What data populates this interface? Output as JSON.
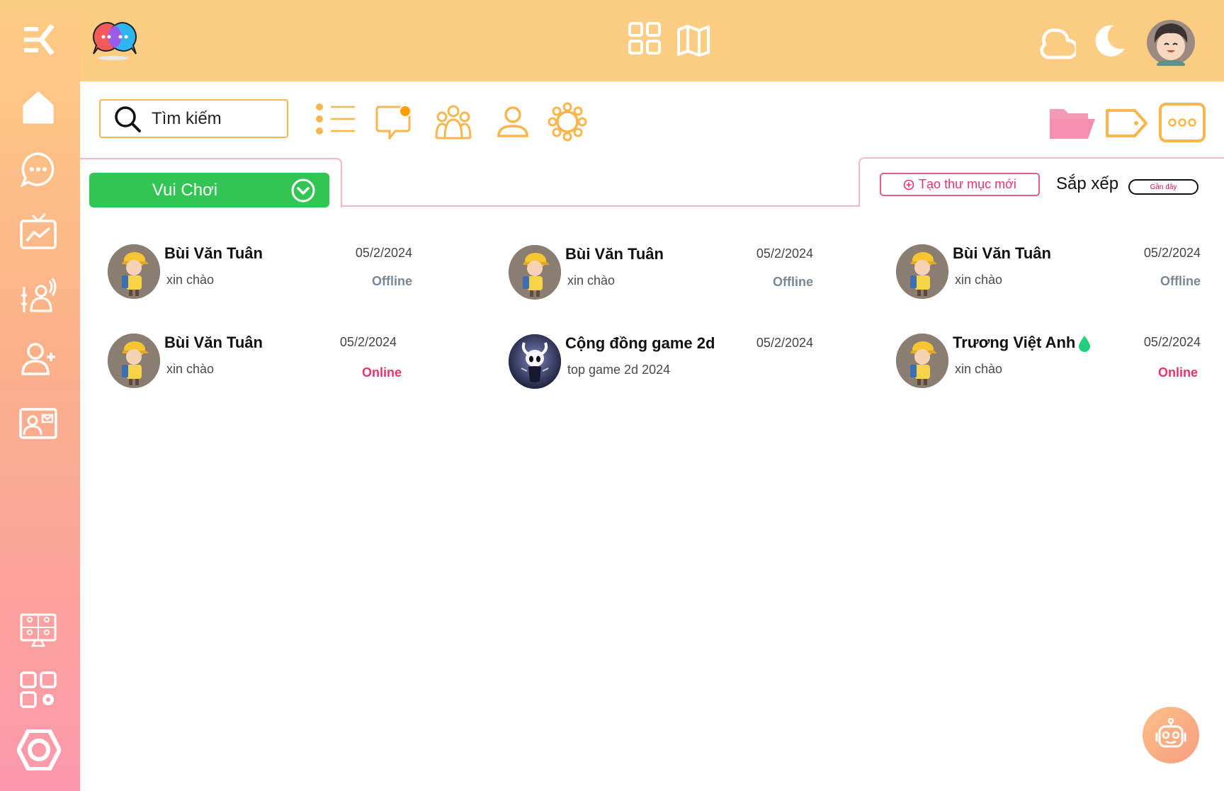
{
  "search": {
    "placeholder": "Tìm kiếm"
  },
  "folder": {
    "selected": "Vui Chơi"
  },
  "actions": {
    "new_folder_label": "Tạo thư mục mới",
    "sort_label": "Sắp xếp",
    "sort_value": "Gần đây"
  },
  "chats": [
    {
      "name": "Bùi Văn Tuân",
      "message": "xin chào",
      "date": "05/2/2024",
      "status": "Offline",
      "avatar": "boy"
    },
    {
      "name": "Bùi Văn Tuân",
      "message": "xin chào",
      "date": "05/2/2024",
      "status": "Offline",
      "avatar": "boy"
    },
    {
      "name": "Bùi Văn Tuân",
      "message": "xin chào",
      "date": "05/2/2024",
      "status": "Offline",
      "avatar": "boy"
    },
    {
      "name": "Bùi Văn Tuân",
      "message": "xin chào",
      "date": "05/2/2024",
      "status": "Online",
      "avatar": "boy"
    },
    {
      "name": "Cộng đồng game 2d",
      "message": "top game 2d 2024",
      "date": "05/2/2024",
      "status": "",
      "avatar": "knight"
    },
    {
      "name": "Trương Việt Anh",
      "message": "xin chào",
      "date": "05/2/2024",
      "status": "Online",
      "avatar": "boy"
    }
  ],
  "colors": {
    "accent_orange": "#f8b64c",
    "folder_green": "#33c553",
    "online_pink": "#e8336b",
    "offline_gray": "#7a8794",
    "top_bar": "#fdcd84"
  },
  "icons": {
    "sidebar": [
      "menu-collapse-icon",
      "home-icon",
      "chat-bubble-icon",
      "live-tv-icon",
      "voice-control-icon",
      "add-user-icon",
      "contact-card-icon",
      "video-meeting-icon",
      "apps-settings-icon",
      "hexagon-settings-icon"
    ],
    "topbar": [
      "app-logo-icon",
      "grid-icon",
      "map-icon",
      "cloud-icon",
      "moon-icon",
      "user-avatar"
    ],
    "toolbar": [
      "search-icon",
      "list-icon",
      "notification-chat-icon",
      "group-icon",
      "person-icon",
      "flower-icon",
      "folder-icon",
      "tag-icon",
      "more-icon"
    ]
  }
}
